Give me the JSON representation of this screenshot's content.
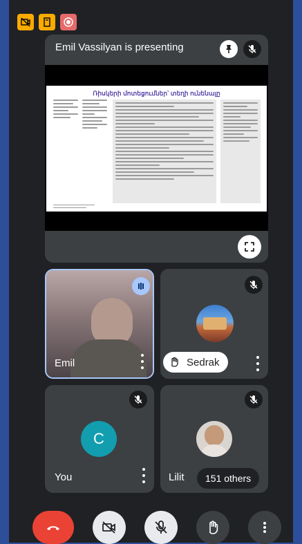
{
  "status_icons": [
    {
      "name": "camera-off-icon",
      "color": "#f9ab00"
    },
    {
      "name": "tablet-icon",
      "color": "#f9ab00"
    },
    {
      "name": "record-icon",
      "color": "#e66a6a"
    }
  ],
  "presentation": {
    "presenter_text": "Emil Vassilyan is presenting",
    "slide_title": "Ռիսկերի մոտեցումներ՝ տեղի ունենալը"
  },
  "participants": [
    {
      "name": "Emil",
      "speaking": true,
      "muted": false
    },
    {
      "name": "Sedrak",
      "hand_raised": true,
      "muted": true
    },
    {
      "name": "You",
      "avatar_letter": "C",
      "avatar_color": "#129eaf",
      "muted": true
    },
    {
      "name": "Lilit",
      "others": "151 others",
      "muted": true
    }
  ],
  "controls": [
    "end-call",
    "camera-off",
    "mic-off",
    "raise-hand",
    "more-options"
  ],
  "colors": {
    "end_call": "#ea4335",
    "controls_bg": "#3c4043",
    "speaking_border": "#a8c7fa",
    "outer_frame": "#2d4f9a"
  }
}
